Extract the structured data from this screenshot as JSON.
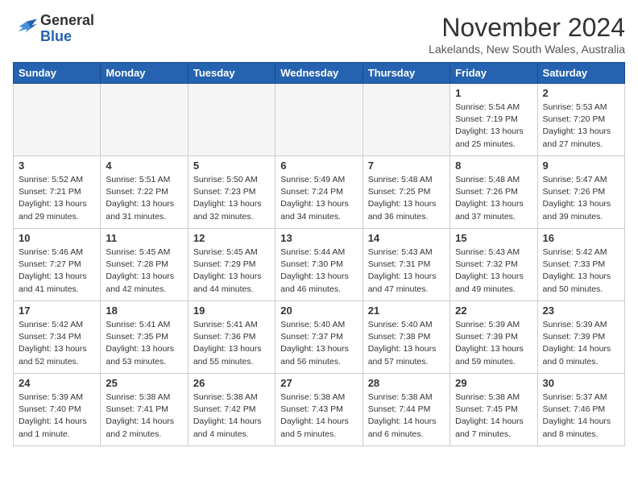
{
  "header": {
    "logo_general": "General",
    "logo_blue": "Blue",
    "month_title": "November 2024",
    "location": "Lakelands, New South Wales, Australia"
  },
  "weekdays": [
    "Sunday",
    "Monday",
    "Tuesday",
    "Wednesday",
    "Thursday",
    "Friday",
    "Saturday"
  ],
  "weeks": [
    [
      {
        "day": "",
        "empty": true
      },
      {
        "day": "",
        "empty": true
      },
      {
        "day": "",
        "empty": true
      },
      {
        "day": "",
        "empty": true
      },
      {
        "day": "",
        "empty": true
      },
      {
        "day": "1",
        "sunrise": "5:54 AM",
        "sunset": "7:19 PM",
        "daylight": "13 hours and 25 minutes."
      },
      {
        "day": "2",
        "sunrise": "5:53 AM",
        "sunset": "7:20 PM",
        "daylight": "13 hours and 27 minutes."
      }
    ],
    [
      {
        "day": "3",
        "sunrise": "5:52 AM",
        "sunset": "7:21 PM",
        "daylight": "13 hours and 29 minutes."
      },
      {
        "day": "4",
        "sunrise": "5:51 AM",
        "sunset": "7:22 PM",
        "daylight": "13 hours and 31 minutes."
      },
      {
        "day": "5",
        "sunrise": "5:50 AM",
        "sunset": "7:23 PM",
        "daylight": "13 hours and 32 minutes."
      },
      {
        "day": "6",
        "sunrise": "5:49 AM",
        "sunset": "7:24 PM",
        "daylight": "13 hours and 34 minutes."
      },
      {
        "day": "7",
        "sunrise": "5:48 AM",
        "sunset": "7:25 PM",
        "daylight": "13 hours and 36 minutes."
      },
      {
        "day": "8",
        "sunrise": "5:48 AM",
        "sunset": "7:26 PM",
        "daylight": "13 hours and 37 minutes."
      },
      {
        "day": "9",
        "sunrise": "5:47 AM",
        "sunset": "7:26 PM",
        "daylight": "13 hours and 39 minutes."
      }
    ],
    [
      {
        "day": "10",
        "sunrise": "5:46 AM",
        "sunset": "7:27 PM",
        "daylight": "13 hours and 41 minutes."
      },
      {
        "day": "11",
        "sunrise": "5:45 AM",
        "sunset": "7:28 PM",
        "daylight": "13 hours and 42 minutes."
      },
      {
        "day": "12",
        "sunrise": "5:45 AM",
        "sunset": "7:29 PM",
        "daylight": "13 hours and 44 minutes."
      },
      {
        "day": "13",
        "sunrise": "5:44 AM",
        "sunset": "7:30 PM",
        "daylight": "13 hours and 46 minutes."
      },
      {
        "day": "14",
        "sunrise": "5:43 AM",
        "sunset": "7:31 PM",
        "daylight": "13 hours and 47 minutes."
      },
      {
        "day": "15",
        "sunrise": "5:43 AM",
        "sunset": "7:32 PM",
        "daylight": "13 hours and 49 minutes."
      },
      {
        "day": "16",
        "sunrise": "5:42 AM",
        "sunset": "7:33 PM",
        "daylight": "13 hours and 50 minutes."
      }
    ],
    [
      {
        "day": "17",
        "sunrise": "5:42 AM",
        "sunset": "7:34 PM",
        "daylight": "13 hours and 52 minutes."
      },
      {
        "day": "18",
        "sunrise": "5:41 AM",
        "sunset": "7:35 PM",
        "daylight": "13 hours and 53 minutes."
      },
      {
        "day": "19",
        "sunrise": "5:41 AM",
        "sunset": "7:36 PM",
        "daylight": "13 hours and 55 minutes."
      },
      {
        "day": "20",
        "sunrise": "5:40 AM",
        "sunset": "7:37 PM",
        "daylight": "13 hours and 56 minutes."
      },
      {
        "day": "21",
        "sunrise": "5:40 AM",
        "sunset": "7:38 PM",
        "daylight": "13 hours and 57 minutes."
      },
      {
        "day": "22",
        "sunrise": "5:39 AM",
        "sunset": "7:39 PM",
        "daylight": "13 hours and 59 minutes."
      },
      {
        "day": "23",
        "sunrise": "5:39 AM",
        "sunset": "7:39 PM",
        "daylight": "14 hours and 0 minutes."
      }
    ],
    [
      {
        "day": "24",
        "sunrise": "5:39 AM",
        "sunset": "7:40 PM",
        "daylight": "14 hours and 1 minute."
      },
      {
        "day": "25",
        "sunrise": "5:38 AM",
        "sunset": "7:41 PM",
        "daylight": "14 hours and 2 minutes."
      },
      {
        "day": "26",
        "sunrise": "5:38 AM",
        "sunset": "7:42 PM",
        "daylight": "14 hours and 4 minutes."
      },
      {
        "day": "27",
        "sunrise": "5:38 AM",
        "sunset": "7:43 PM",
        "daylight": "14 hours and 5 minutes."
      },
      {
        "day": "28",
        "sunrise": "5:38 AM",
        "sunset": "7:44 PM",
        "daylight": "14 hours and 6 minutes."
      },
      {
        "day": "29",
        "sunrise": "5:38 AM",
        "sunset": "7:45 PM",
        "daylight": "14 hours and 7 minutes."
      },
      {
        "day": "30",
        "sunrise": "5:37 AM",
        "sunset": "7:46 PM",
        "daylight": "14 hours and 8 minutes."
      }
    ]
  ],
  "labels": {
    "sunrise": "Sunrise:",
    "sunset": "Sunset:",
    "daylight": "Daylight:"
  }
}
